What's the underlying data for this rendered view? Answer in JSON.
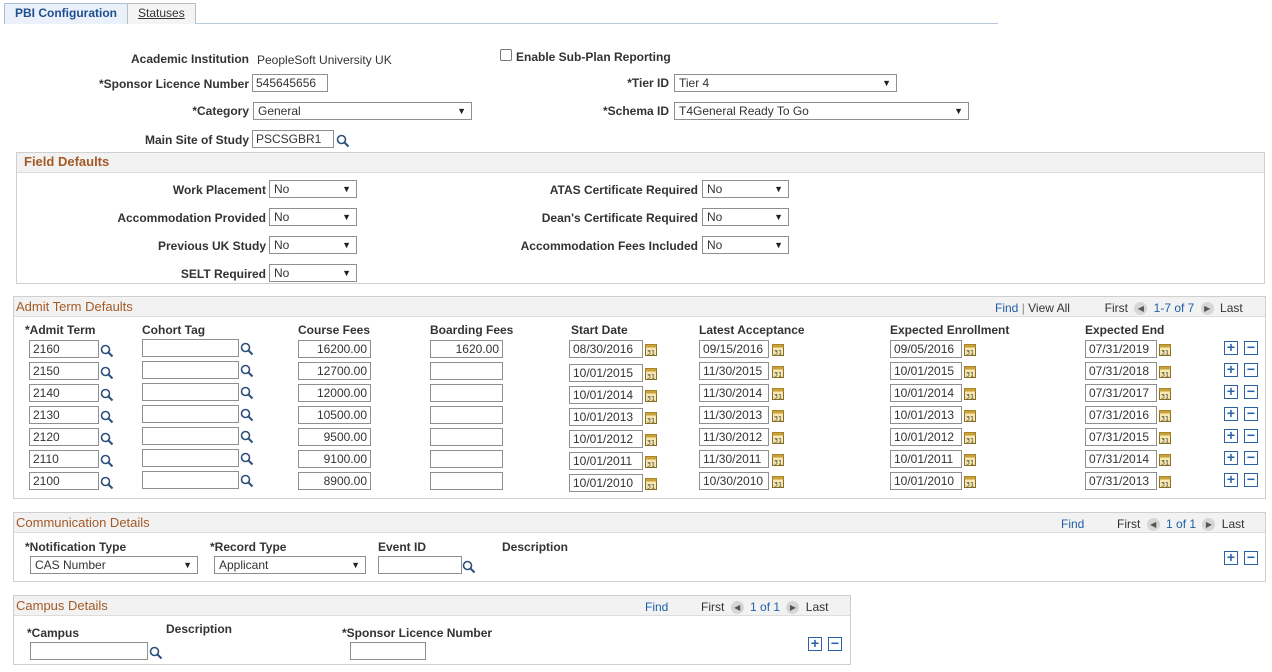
{
  "tabs": [
    {
      "label": "PBI Configuration",
      "active": true
    },
    {
      "label": "Statuses",
      "active": false
    }
  ],
  "header_form": {
    "academic_institution_label": "Academic Institution",
    "academic_institution_value": "PeopleSoft University UK",
    "enable_subplan_label": "Enable Sub-Plan Reporting",
    "sponsor_licence_label": "*Sponsor Licence Number",
    "sponsor_licence_value": "545645656",
    "tier_id_label": "*Tier ID",
    "tier_id_value": "Tier 4",
    "category_label": "*Category",
    "category_value": "General",
    "schema_id_label": "*Schema ID",
    "schema_id_value": "T4General Ready To Go",
    "main_site_label": "Main Site of Study",
    "main_site_value": "PSCSGBR1"
  },
  "field_defaults": {
    "title": "Field Defaults",
    "left": [
      {
        "label": "Work Placement",
        "value": "No"
      },
      {
        "label": "Accommodation Provided",
        "value": "No"
      },
      {
        "label": "Previous UK Study",
        "value": "No"
      },
      {
        "label": "SELT Required",
        "value": "No"
      }
    ],
    "right": [
      {
        "label": "ATAS Certificate Required",
        "value": "No"
      },
      {
        "label": "Dean's Certificate Required",
        "value": "No"
      },
      {
        "label": "Accommodation Fees Included",
        "value": "No"
      }
    ]
  },
  "admit_term": {
    "title": "Admit Term Defaults",
    "nav": {
      "find": "Find",
      "view_all": "View All",
      "first": "First",
      "range": "1-7 of 7",
      "last": "Last"
    },
    "columns": [
      "*Admit Term",
      "Cohort Tag",
      "Course Fees",
      "Boarding Fees",
      "Start Date",
      "Latest Acceptance",
      "Expected Enrollment",
      "Expected End"
    ],
    "rows": [
      {
        "term": "2160",
        "cohort": "",
        "course": "16200.00",
        "boarding": "1620.00",
        "start": "08/30/2016",
        "latest": "09/15/2016",
        "enroll": "09/05/2016",
        "end": "07/31/2019"
      },
      {
        "term": "2150",
        "cohort": "",
        "course": "12700.00",
        "boarding": "",
        "start": "10/01/2015",
        "latest": "11/30/2015",
        "enroll": "10/01/2015",
        "end": "07/31/2018"
      },
      {
        "term": "2140",
        "cohort": "",
        "course": "12000.00",
        "boarding": "",
        "start": "10/01/2014",
        "latest": "11/30/2014",
        "enroll": "10/01/2014",
        "end": "07/31/2017"
      },
      {
        "term": "2130",
        "cohort": "",
        "course": "10500.00",
        "boarding": "",
        "start": "10/01/2013",
        "latest": "11/30/2013",
        "enroll": "10/01/2013",
        "end": "07/31/2016"
      },
      {
        "term": "2120",
        "cohort": "",
        "course": "9500.00",
        "boarding": "",
        "start": "10/01/2012",
        "latest": "11/30/2012",
        "enroll": "10/01/2012",
        "end": "07/31/2015"
      },
      {
        "term": "2110",
        "cohort": "",
        "course": "9100.00",
        "boarding": "",
        "start": "10/01/2011",
        "latest": "11/30/2011",
        "enroll": "10/01/2011",
        "end": "07/31/2014"
      },
      {
        "term": "2100",
        "cohort": "",
        "course": "8900.00",
        "boarding": "",
        "start": "10/01/2010",
        "latest": "10/30/2010",
        "enroll": "10/01/2010",
        "end": "07/31/2013"
      }
    ]
  },
  "communication": {
    "title": "Communication Details",
    "nav": {
      "find": "Find",
      "first": "First",
      "range": "1 of 1",
      "last": "Last"
    },
    "notification_label": "*Notification Type",
    "notification_value": "CAS Number",
    "record_label": "*Record Type",
    "record_value": "Applicant",
    "event_label": "Event ID",
    "event_value": "",
    "description_label": "Description"
  },
  "campus": {
    "title": "Campus Details",
    "nav": {
      "find": "Find",
      "first": "First",
      "range": "1 of 1",
      "last": "Last"
    },
    "campus_label": "*Campus",
    "campus_value": "",
    "description_label": "Description",
    "sponsor_label": "*Sponsor Licence Number",
    "sponsor_value": ""
  },
  "colors": {
    "accent": "#1f5fa8",
    "section_title": "#a35a26",
    "border": "#cfcfcf"
  }
}
